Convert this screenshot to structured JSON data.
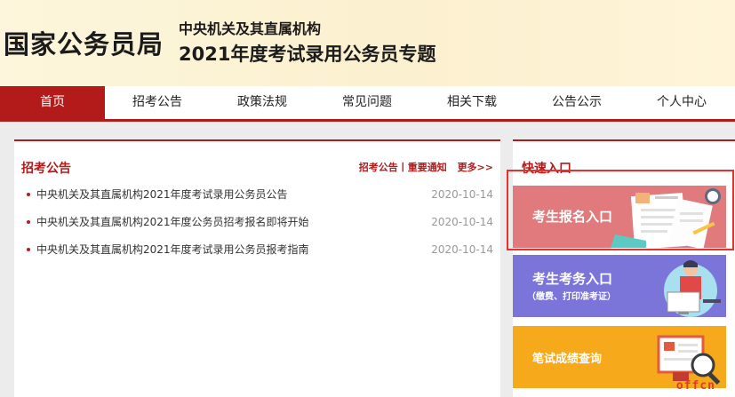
{
  "header": {
    "site_name": "国家公务员局",
    "subtitle_line1": "中央机关及其直属机构",
    "subtitle_line2": "2021年度考试录用公务员专题"
  },
  "nav": {
    "items": [
      {
        "label": "首页",
        "active": true
      },
      {
        "label": "招考公告"
      },
      {
        "label": "政策法规"
      },
      {
        "label": "常见问题"
      },
      {
        "label": "相关下载"
      },
      {
        "label": "公告公示"
      },
      {
        "label": "个人中心"
      }
    ]
  },
  "notices": {
    "title": "招考公告",
    "links": "招考公告丨重要通知",
    "more": "更多>>",
    "items": [
      {
        "title": "中央机关及其直属机构2021年度考试录用公务员公告",
        "date": "2020-10-14"
      },
      {
        "title": "中央机关及其直属机构2021年度公务员招考报名即将开始",
        "date": "2020-10-14"
      },
      {
        "title": "中央机关及其直属机构2021年度考试录用公务员报考指南",
        "date": "2020-10-14"
      }
    ]
  },
  "quick": {
    "title": "快速入口",
    "entries": [
      {
        "label": "考生报名入口",
        "sub": ""
      },
      {
        "label": "考生考务入口",
        "sub": "（缴费、打印准考证）"
      },
      {
        "label": "笔试成绩查询",
        "sub": ""
      }
    ]
  },
  "watermark": "offcn",
  "colors": {
    "accent": "#b31b1b",
    "entry_register": "#e07a7c",
    "entry_affairs": "#7b75d9",
    "entry_scores": "#f5a91b",
    "highlight": "#e8302e"
  }
}
